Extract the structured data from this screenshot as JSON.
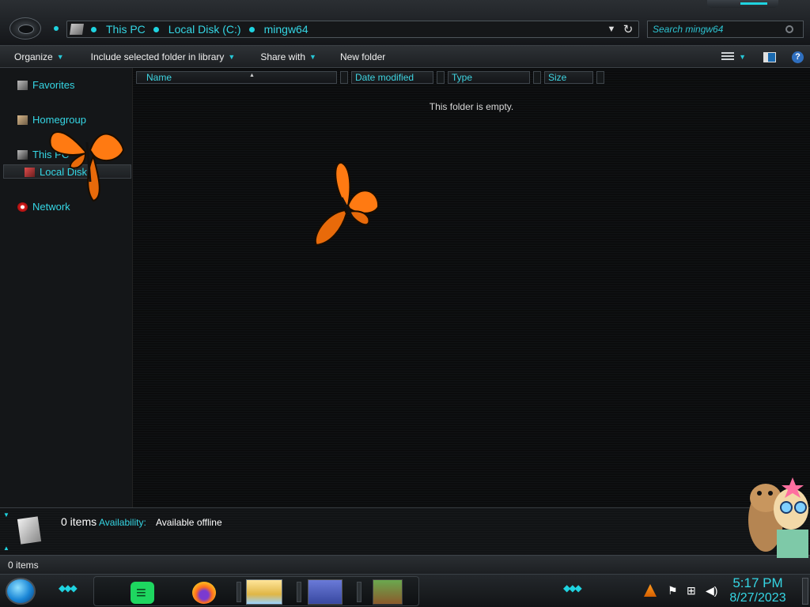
{
  "address": {
    "crumbs": [
      "This PC",
      "Local Disk (C:)",
      "mingw64"
    ],
    "dropdown_icon": "chevron-down-icon",
    "refresh_icon": "refresh-icon"
  },
  "search": {
    "placeholder": "Search mingw64"
  },
  "toolbar": {
    "organize": "Organize",
    "include": "Include selected folder in library",
    "share": "Share with",
    "new_folder": "New folder"
  },
  "nav": {
    "favorites": "Favorites",
    "homegroup": "Homegroup",
    "this_pc": "This PC",
    "local_disk": "Local Disk",
    "network": "Network"
  },
  "columns": [
    "Name",
    "Date modified",
    "Type",
    "Size"
  ],
  "content": {
    "empty_message": "This folder is empty."
  },
  "details": {
    "count": "0 items",
    "availability_label": "Availability:",
    "availability_value": "Available offline"
  },
  "status": {
    "count": "0 items"
  },
  "clock": {
    "time": "5:17 PM",
    "date": "8/27/2023"
  },
  "taskbar": {
    "apps": [
      "spotify-icon",
      "firefox-icon",
      "file-explorer-icon",
      "window-icon",
      "box-icon"
    ]
  },
  "colors": {
    "accent": "#35d6e4",
    "background": "#0a0b0c",
    "butterfly": "#ff7a12"
  }
}
